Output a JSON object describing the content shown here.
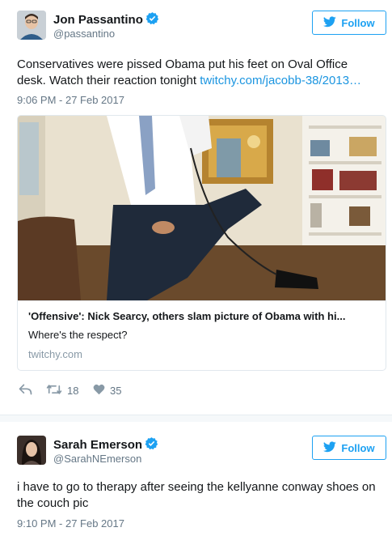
{
  "tweets": [
    {
      "name": "Jon Passantino",
      "handle": "@passantino",
      "follow_label": "Follow",
      "text_plain": "Conservatives were pissed Obama put his feet on Oval Office desk. Watch their reaction tonight ",
      "text_link": "twitchy.com/jacobb-38/2013…",
      "timestamp": "9:06 PM - 27 Feb 2017",
      "card": {
        "title": "'Offensive': Nick Searcy, others slam picture of Obama with hi...",
        "description": "Where's the respect?",
        "domain": "twitchy.com"
      },
      "actions": {
        "retweets": "18",
        "likes": "35"
      }
    },
    {
      "name": "Sarah Emerson",
      "handle": "@SarahNEmerson",
      "follow_label": "Follow",
      "text_plain": "i have to go to therapy after seeing the kellyanne conway shoes on the couch pic",
      "timestamp": "9:10 PM - 27 Feb 2017"
    }
  ],
  "colors": {
    "accent": "#1da1f2",
    "link": "#1b95e0",
    "muted": "#657786",
    "border": "#e1e8ed"
  }
}
